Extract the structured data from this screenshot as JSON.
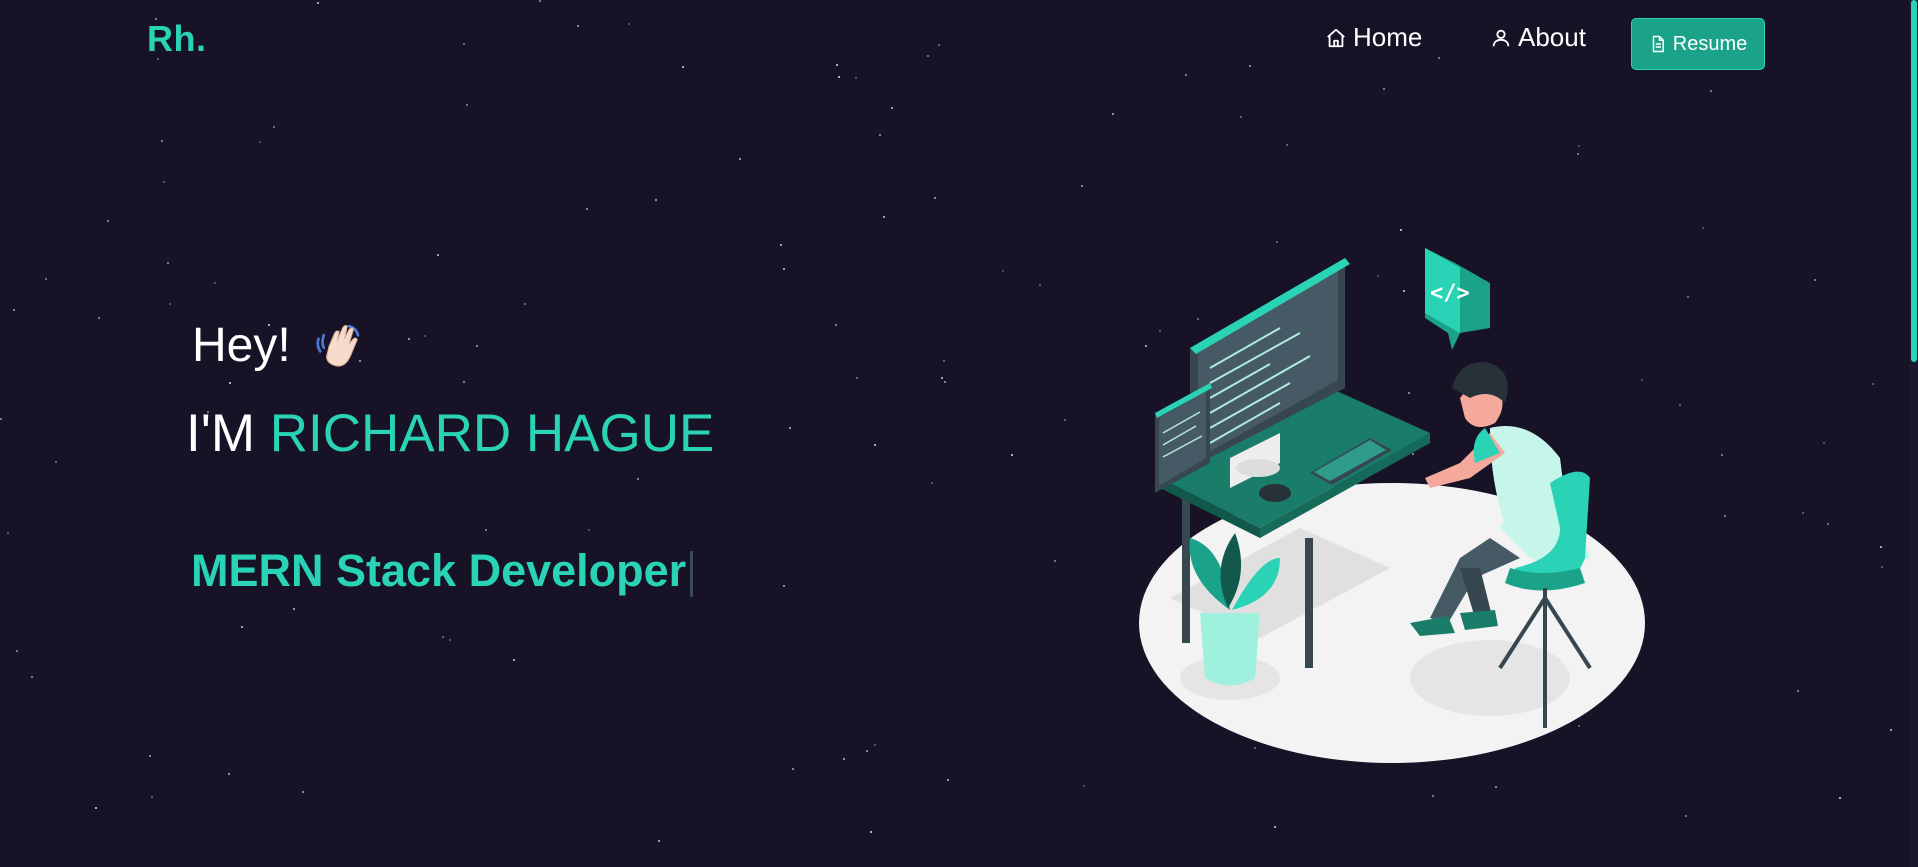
{
  "nav": {
    "logo": "Rh.",
    "home_label": "Home",
    "about_label": "About",
    "resume_label": "Resume"
  },
  "hero": {
    "greeting": "Hey!",
    "intro_prefix": "I'M ",
    "name": "RICHARD HAGUE",
    "role": "MERN Stack Developer"
  },
  "colors": {
    "background": "#171226",
    "accent": "#2ad3b5",
    "button": "#1aa388"
  },
  "icons": [
    "home-icon",
    "user-icon",
    "document-icon",
    "waving-hand-icon",
    "code-bubble-icon"
  ]
}
